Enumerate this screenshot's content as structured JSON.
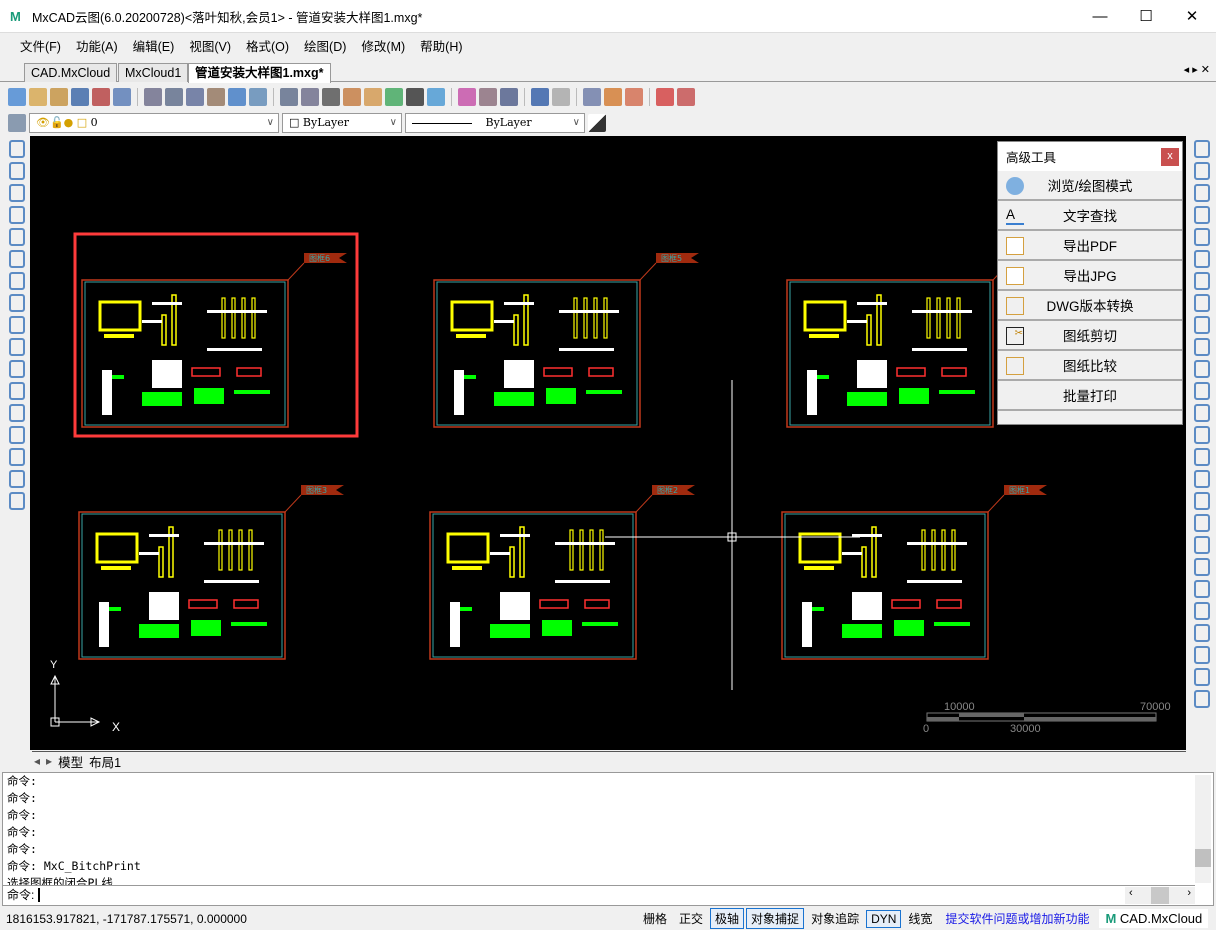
{
  "window": {
    "title": "MxCAD云图(6.0.20200728)<落叶知秋,会员1> - 管道安装大样图1.mxg*",
    "minimize": "—",
    "maximize": "☐",
    "close": "✕"
  },
  "menu": [
    "文件(F)",
    "功能(A)",
    "编辑(E)",
    "视图(V)",
    "格式(O)",
    "绘图(D)",
    "修改(M)",
    "帮助(H)"
  ],
  "tabs": [
    {
      "label": "CAD.MxCloud",
      "active": false
    },
    {
      "label": "MxCloud1",
      "active": false
    },
    {
      "label": "管道安装大样图1.mxg*",
      "active": true
    }
  ],
  "tab_nav": "◂ ▸ ✕",
  "properties_toolbar": {
    "layer": "0",
    "color": "ByLayer",
    "linetype": "ByLayer"
  },
  "canvas": {
    "background": "#000000",
    "frames": [
      {
        "label": "图框6",
        "selected": true
      },
      {
        "label": "图框5",
        "selected": false
      },
      {
        "label": "图框4",
        "selected": false
      },
      {
        "label": "图框3",
        "selected": false
      },
      {
        "label": "图框2",
        "selected": false
      },
      {
        "label": "图框1",
        "selected": false
      }
    ],
    "scale_bar": {
      "top_labels": [
        "10000",
        "70000"
      ],
      "bottom_labels": [
        "0",
        "30000"
      ]
    },
    "ucs": {
      "x": "X",
      "y": "Y"
    }
  },
  "panel": {
    "title": "高级工具",
    "close": "x",
    "items": [
      "浏览/绘图模式",
      "文字查找",
      "导出PDF",
      "导出JPG",
      "DWG版本转换",
      "图纸剪切",
      "图纸比较",
      "批量打印"
    ]
  },
  "layout_tabs": [
    "模型",
    "布局1"
  ],
  "command": {
    "history": [
      "命令:",
      "命令:",
      "命令:",
      "命令:",
      "命令:",
      "命令:  MxC_BitchPrint",
      " 选择图框的闭合PL线"
    ],
    "prompt": "命令:"
  },
  "status": {
    "coords": "1816153.917821,  -171787.175571,  0.000000",
    "toggles": [
      {
        "label": "栅格",
        "on": false
      },
      {
        "label": "正交",
        "on": false
      },
      {
        "label": "极轴",
        "on": true
      },
      {
        "label": "对象捕捉",
        "on": true
      },
      {
        "label": "对象追踪",
        "on": false
      },
      {
        "label": "DYN",
        "on": true
      },
      {
        "label": "线宽",
        "on": false
      }
    ],
    "feedback_link": "提交软件问题或增加新功能",
    "brand": "CAD.MxCloud"
  },
  "colors": {
    "accent": "#1a73d0",
    "link": "#1a1ae6",
    "highlight": "#ff3b3b",
    "frame": "#c0391b",
    "inner_frame": "#3aa6a6",
    "label_flag": "#a02a0e"
  }
}
